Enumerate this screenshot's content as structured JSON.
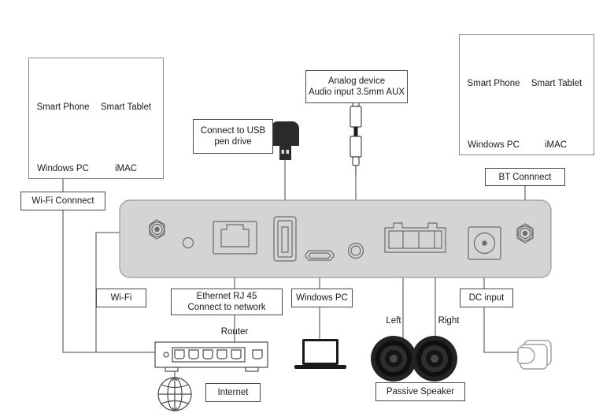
{
  "diagram": {
    "title": "Audio streaming device rear panel connection diagram",
    "panel_color": "#d4d4d4",
    "line_color": "#6b6b6b"
  },
  "left_group": {
    "name": "wifi-device-group",
    "devices": [
      {
        "icon": "smart-phone-icon",
        "label": "Smart Phone"
      },
      {
        "icon": "smart-tablet-icon",
        "label": "Smart Tablet"
      },
      {
        "icon": "windows-pc-monitor-icon",
        "label": "Windows PC"
      },
      {
        "icon": "imac-monitor-icon",
        "label": "iMAC"
      }
    ],
    "connect_label": "Wi-Fi Connnect"
  },
  "right_group": {
    "name": "bluetooth-device-group",
    "devices": [
      {
        "icon": "smart-phone-icon",
        "label": "Smart Phone"
      },
      {
        "icon": "smart-tablet-icon",
        "label": "Smart Tablet"
      },
      {
        "icon": "windows-pc-monitor-icon",
        "label": "Windows PC"
      },
      {
        "icon": "imac-monitor-icon",
        "label": "iMAC"
      }
    ],
    "connect_label": "BT Connnect"
  },
  "labels": {
    "usb_pen_drive": "Connect to USB\npen drive",
    "usb_pen_drive_line1": "Connect to USB",
    "usb_pen_drive_line2": "pen drive",
    "analog_line1": "Analog device",
    "analog_line2": "Audio input 3.5mm AUX",
    "wifi": "Wi-Fi",
    "ethernet_line1": "Ethernet RJ 45",
    "ethernet_line2": "Connect to network",
    "windows_pc": "Windows PC",
    "dc_input": "DC input",
    "router": "Router",
    "internet": "Internet",
    "left": "Left",
    "right": "Right",
    "passive_speaker": "Passive Speaker"
  },
  "ports": [
    {
      "name": "wifi-antenna-connector",
      "type": "sma-antenna"
    },
    {
      "name": "status-led",
      "type": "led"
    },
    {
      "name": "ethernet-rj45-port",
      "type": "rj45"
    },
    {
      "name": "usb-a-port",
      "type": "usb-a"
    },
    {
      "name": "micro-usb-port",
      "type": "micro-usb"
    },
    {
      "name": "aux-35mm-jack",
      "type": "audio-jack"
    },
    {
      "name": "speaker-terminal-block",
      "type": "terminal"
    },
    {
      "name": "dc-power-jack",
      "type": "dc-barrel"
    },
    {
      "name": "bluetooth-antenna-connector",
      "type": "sma-antenna"
    }
  ],
  "peripherals": [
    {
      "name": "usb-flash-drive-icon"
    },
    {
      "name": "rca-audio-cable-icon"
    },
    {
      "name": "laptop-icon"
    },
    {
      "name": "router-icon"
    },
    {
      "name": "globe-internet-icon"
    },
    {
      "name": "speaker-left-icon"
    },
    {
      "name": "speaker-right-icon"
    },
    {
      "name": "power-adapter-icon"
    }
  ]
}
